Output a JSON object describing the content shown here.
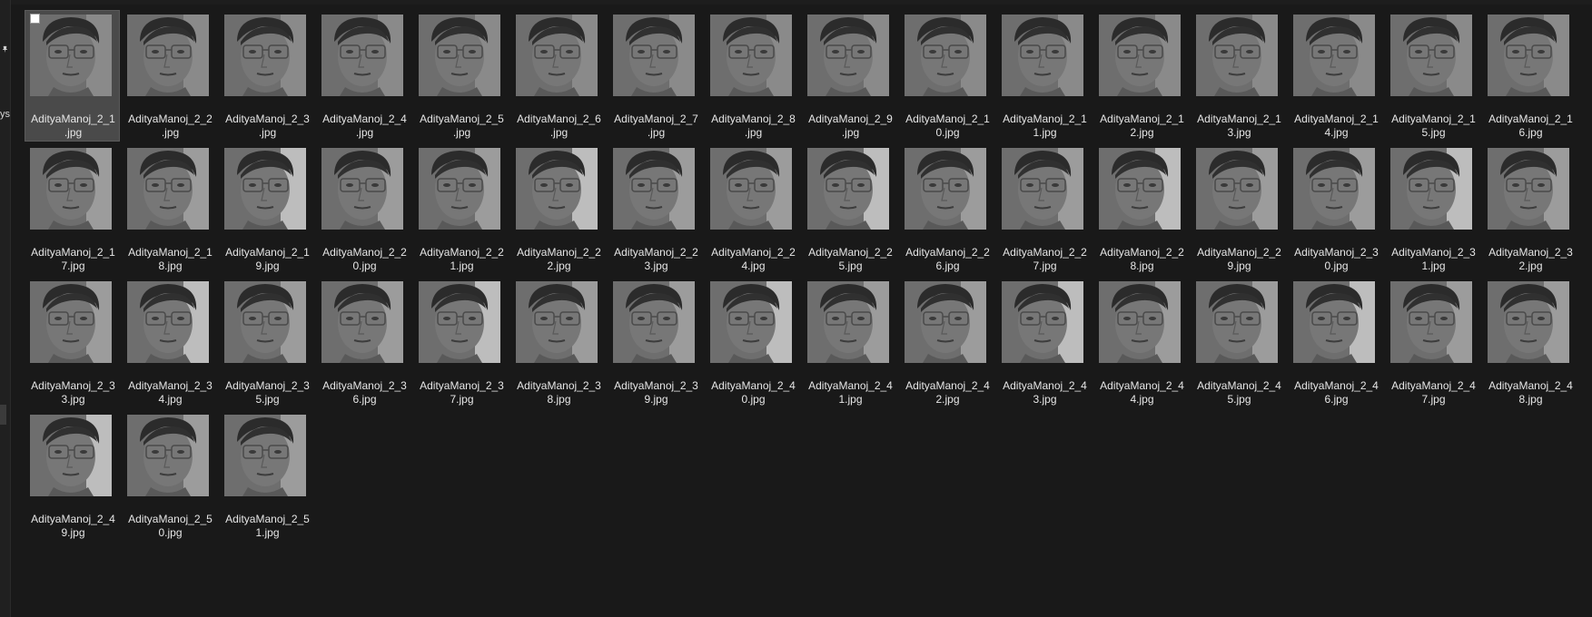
{
  "sidebar": {
    "pin_icon": "pin-icon",
    "truncated_label": "ys"
  },
  "colors": {
    "background": "#191919",
    "tile_selected": "#4a4a4a",
    "text": "#e6e6e6"
  },
  "files": [
    {
      "line1": "AdityaManoj_2_1",
      "line2": ".jpg",
      "selected": true
    },
    {
      "line1": "AdityaManoj_2_2",
      "line2": ".jpg"
    },
    {
      "line1": "AdityaManoj_2_3",
      "line2": ".jpg"
    },
    {
      "line1": "AdityaManoj_2_4",
      "line2": ".jpg"
    },
    {
      "line1": "AdityaManoj_2_5",
      "line2": ".jpg"
    },
    {
      "line1": "AdityaManoj_2_6",
      "line2": ".jpg"
    },
    {
      "line1": "AdityaManoj_2_7",
      "line2": ".jpg"
    },
    {
      "line1": "AdityaManoj_2_8",
      "line2": ".jpg"
    },
    {
      "line1": "AdityaManoj_2_9",
      "line2": ".jpg"
    },
    {
      "line1": "AdityaManoj_2_1",
      "line2": "0.jpg"
    },
    {
      "line1": "AdityaManoj_2_1",
      "line2": "1.jpg"
    },
    {
      "line1": "AdityaManoj_2_1",
      "line2": "2.jpg"
    },
    {
      "line1": "AdityaManoj_2_1",
      "line2": "3.jpg"
    },
    {
      "line1": "AdityaManoj_2_1",
      "line2": "4.jpg"
    },
    {
      "line1": "AdityaManoj_2_1",
      "line2": "5.jpg"
    },
    {
      "line1": "AdityaManoj_2_1",
      "line2": "6.jpg"
    },
    {
      "line1": "AdityaManoj_2_1",
      "line2": "7.jpg"
    },
    {
      "line1": "AdityaManoj_2_1",
      "line2": "8.jpg"
    },
    {
      "line1": "AdityaManoj_2_1",
      "line2": "9.jpg"
    },
    {
      "line1": "AdityaManoj_2_2",
      "line2": "0.jpg"
    },
    {
      "line1": "AdityaManoj_2_2",
      "line2": "1.jpg"
    },
    {
      "line1": "AdityaManoj_2_2",
      "line2": "2.jpg"
    },
    {
      "line1": "AdityaManoj_2_2",
      "line2": "3.jpg"
    },
    {
      "line1": "AdityaManoj_2_2",
      "line2": "4.jpg"
    },
    {
      "line1": "AdityaManoj_2_2",
      "line2": "5.jpg"
    },
    {
      "line1": "AdityaManoj_2_2",
      "line2": "6.jpg"
    },
    {
      "line1": "AdityaManoj_2_2",
      "line2": "7.jpg"
    },
    {
      "line1": "AdityaManoj_2_2",
      "line2": "8.jpg"
    },
    {
      "line1": "AdityaManoj_2_2",
      "line2": "9.jpg"
    },
    {
      "line1": "AdityaManoj_2_3",
      "line2": "0.jpg"
    },
    {
      "line1": "AdityaManoj_2_3",
      "line2": "1.jpg"
    },
    {
      "line1": "AdityaManoj_2_3",
      "line2": "2.jpg"
    },
    {
      "line1": "AdityaManoj_2_3",
      "line2": "3.jpg"
    },
    {
      "line1": "AdityaManoj_2_3",
      "line2": "4.jpg"
    },
    {
      "line1": "AdityaManoj_2_3",
      "line2": "5.jpg"
    },
    {
      "line1": "AdityaManoj_2_3",
      "line2": "6.jpg"
    },
    {
      "line1": "AdityaManoj_2_3",
      "line2": "7.jpg"
    },
    {
      "line1": "AdityaManoj_2_3",
      "line2": "8.jpg"
    },
    {
      "line1": "AdityaManoj_2_3",
      "line2": "9.jpg"
    },
    {
      "line1": "AdityaManoj_2_4",
      "line2": "0.jpg"
    },
    {
      "line1": "AdityaManoj_2_4",
      "line2": "1.jpg"
    },
    {
      "line1": "AdityaManoj_2_4",
      "line2": "2.jpg"
    },
    {
      "line1": "AdityaManoj_2_4",
      "line2": "3.jpg"
    },
    {
      "line1": "AdityaManoj_2_4",
      "line2": "4.jpg"
    },
    {
      "line1": "AdityaManoj_2_4",
      "line2": "5.jpg"
    },
    {
      "line1": "AdityaManoj_2_4",
      "line2": "6.jpg"
    },
    {
      "line1": "AdityaManoj_2_4",
      "line2": "7.jpg"
    },
    {
      "line1": "AdityaManoj_2_4",
      "line2": "8.jpg"
    },
    {
      "line1": "AdityaManoj_2_4",
      "line2": "9.jpg"
    },
    {
      "line1": "AdityaManoj_2_5",
      "line2": "0.jpg"
    },
    {
      "line1": "AdityaManoj_2_5",
      "line2": "1.jpg"
    }
  ]
}
